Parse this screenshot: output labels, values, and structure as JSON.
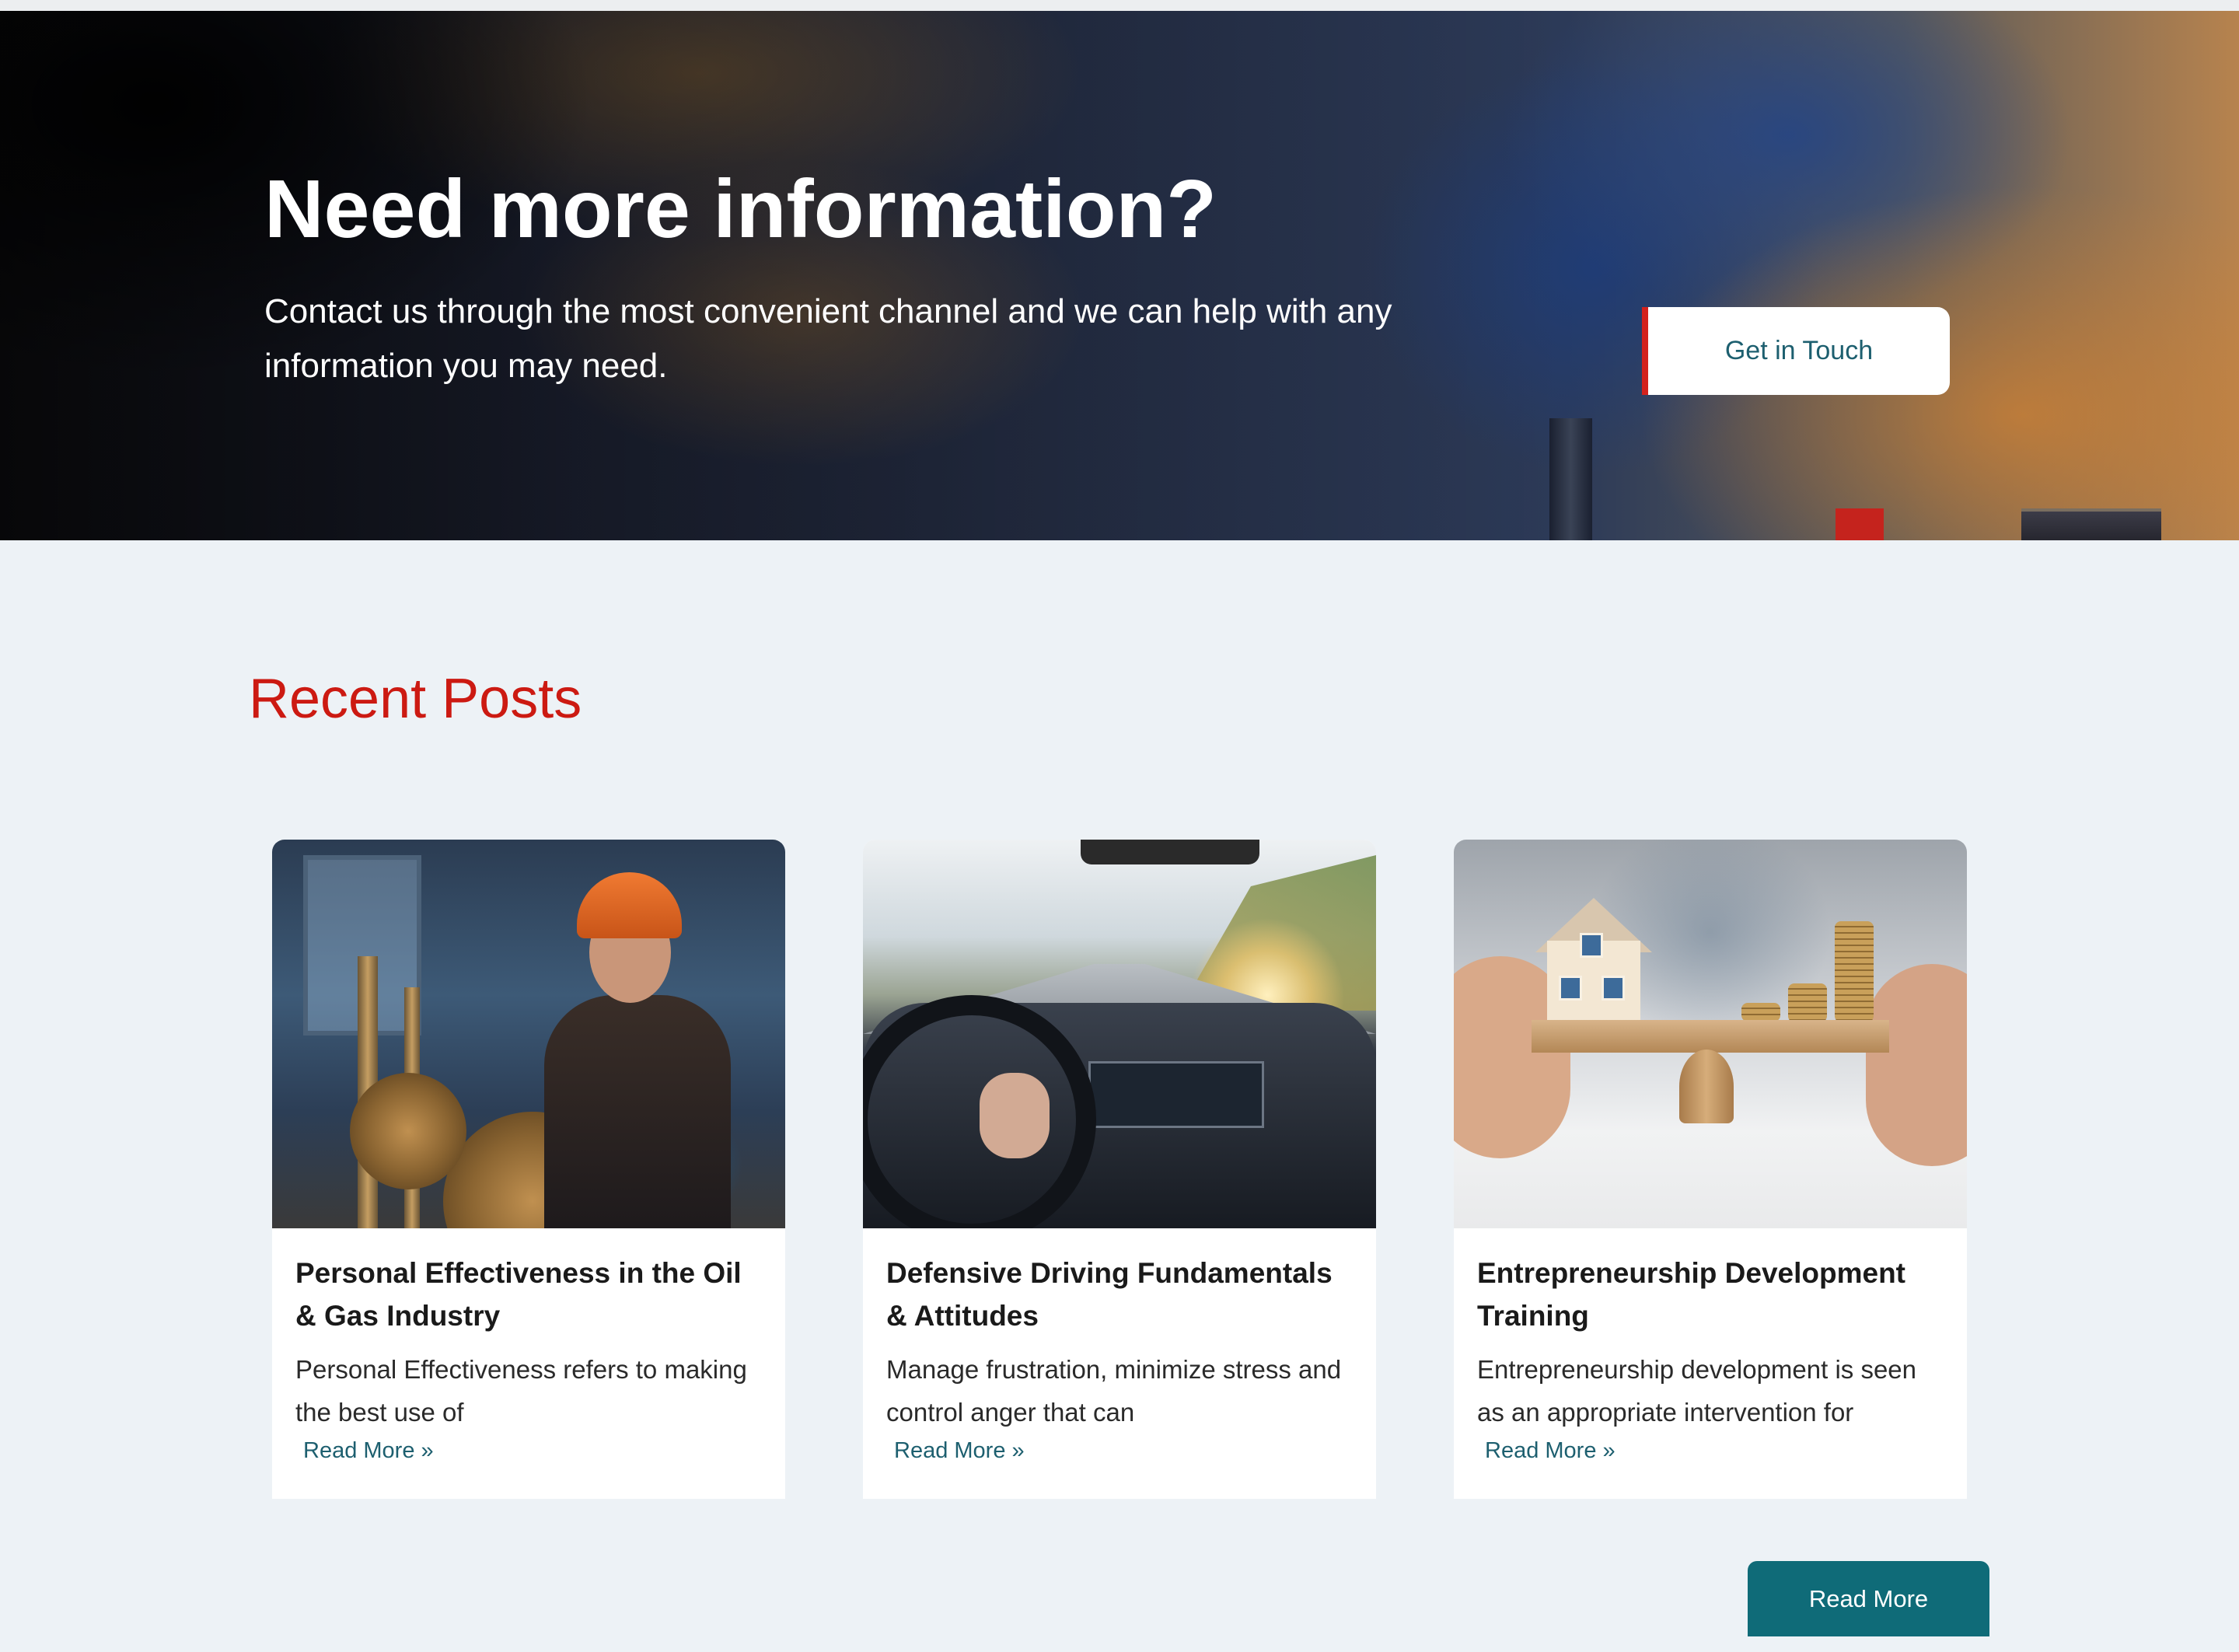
{
  "hero": {
    "title": "Need more information?",
    "subtitle": "Contact us through the most convenient channel and we can help with any information you may need.",
    "cta_label": "Get in Touch"
  },
  "recent_posts": {
    "heading": "Recent Posts",
    "posts": [
      {
        "title": "Personal Effectiveness in the Oil & Gas Industry",
        "excerpt": "Personal Effectiveness refers to making the best use of",
        "link_label": "Read More »",
        "image": "oil-gas-worker-photo"
      },
      {
        "title": "Defensive Driving Fundamentals & Attitudes",
        "excerpt": "Manage frustration, minimize stress and control anger that can",
        "link_label": "Read More »",
        "image": "car-dashboard-photo"
      },
      {
        "title": "Entrepreneurship Development Training",
        "excerpt": "Entrepreneurship development is seen as an appropriate intervention for",
        "link_label": "Read More »",
        "image": "house-coins-balance-photo"
      }
    ],
    "more_button_label": "Read More"
  },
  "colors": {
    "accent_red": "#cc1a12",
    "link_teal": "#1d5f6f",
    "button_teal": "#0f6b78",
    "page_background": "#edf2f6"
  }
}
